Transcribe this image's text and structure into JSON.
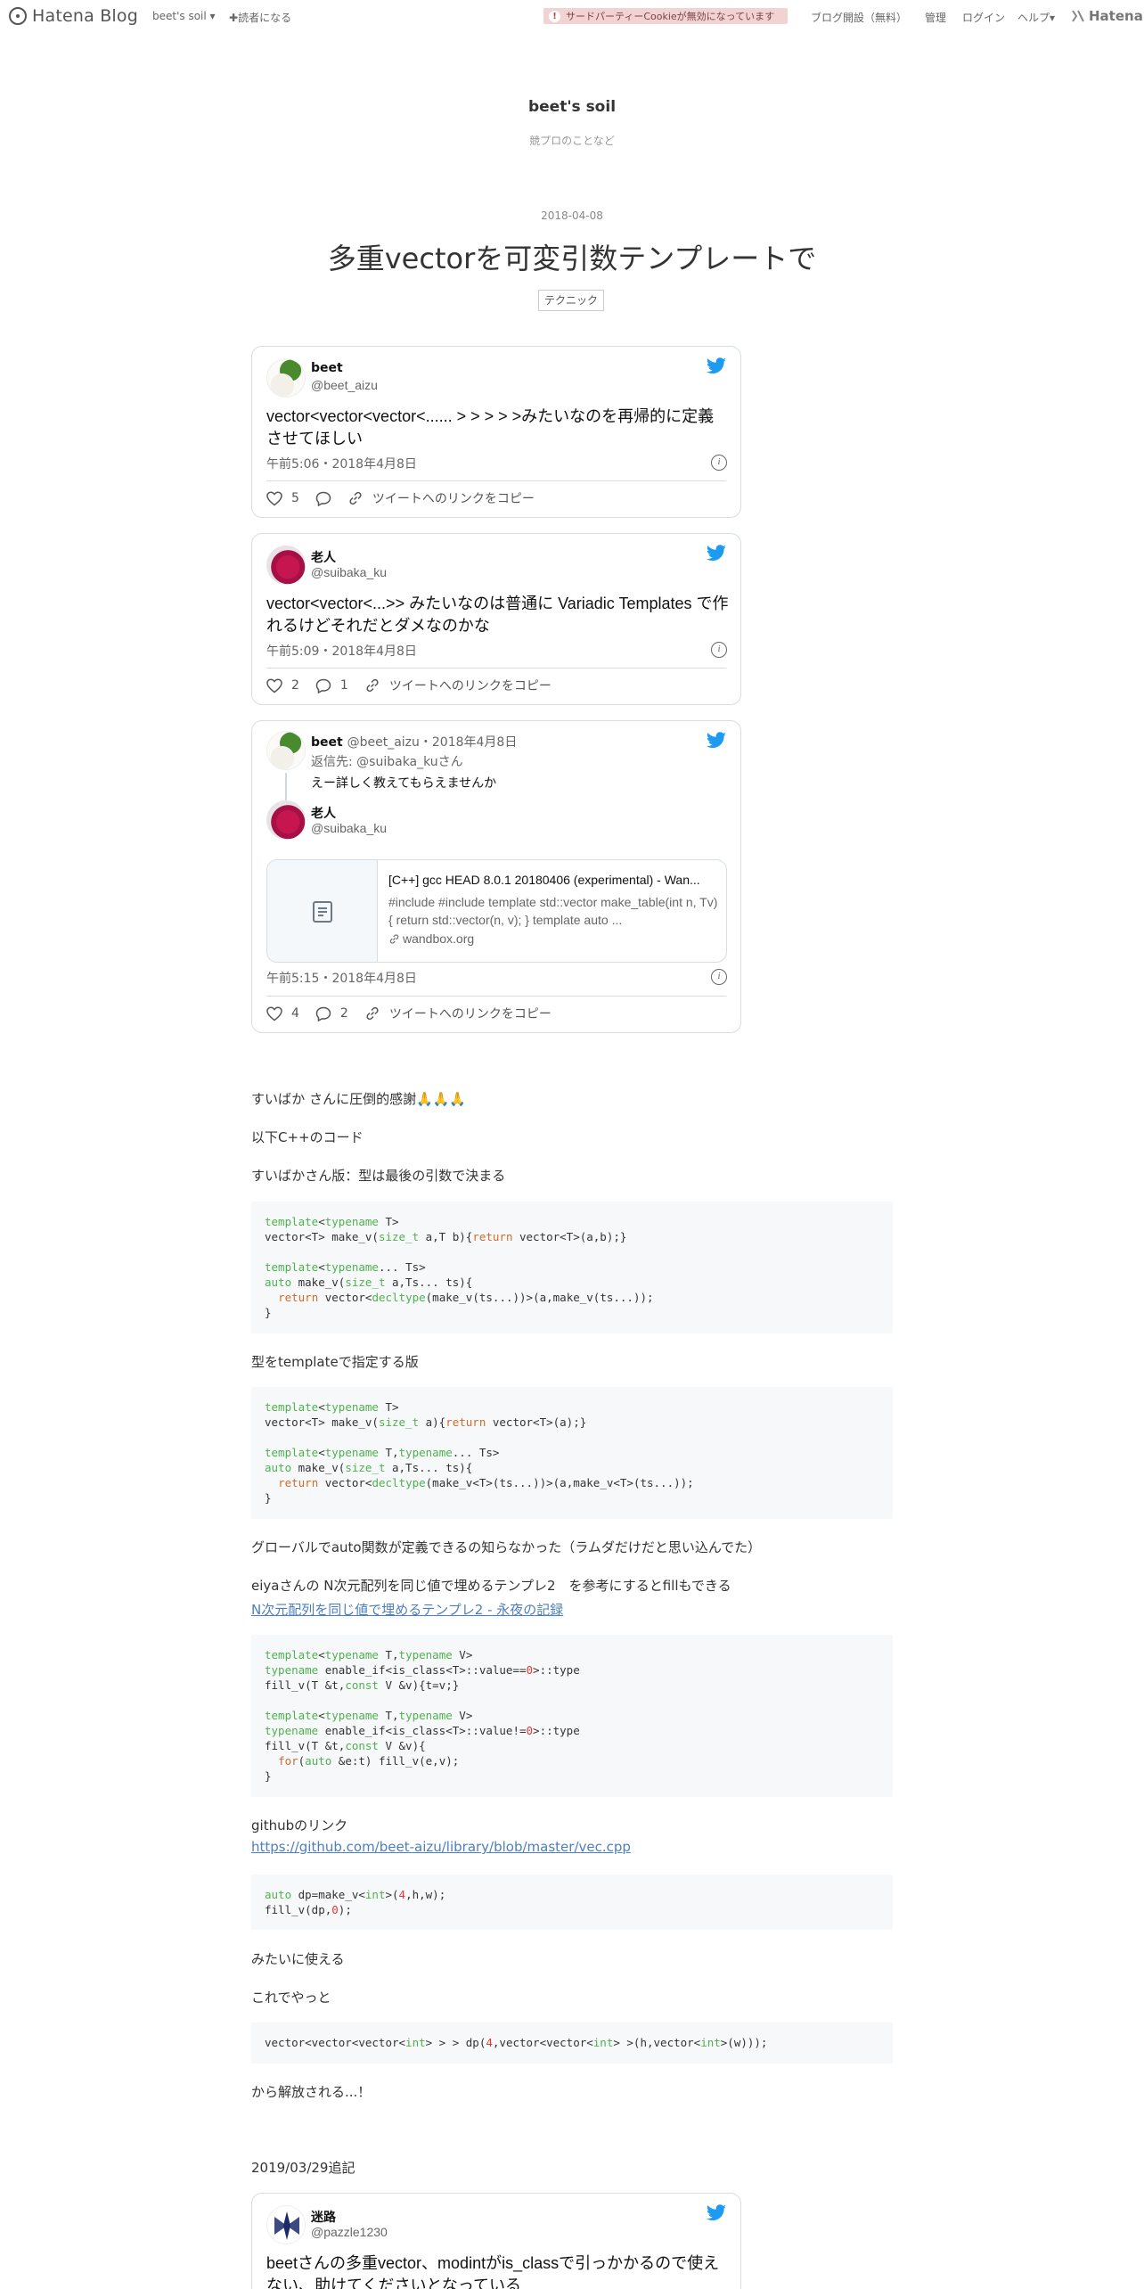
{
  "global_header": {
    "logo_text": "Hatena Blog",
    "blog_menu": "beet's soil",
    "subscribe": "読者になる",
    "notice": "サードパーティーCookieが無効になっています",
    "open_blog": "ブログ開設（無料）",
    "admin": "管理",
    "login": "ログイン",
    "help": "ヘルプ",
    "hatena": "Hatena"
  },
  "blog": {
    "title": "beet's soil",
    "description": "競プロのことなど"
  },
  "entry": {
    "date": "2018-04-08",
    "title": "多重vectorを可変引数テンプレートで",
    "category": "テクニック"
  },
  "tweets": [
    {
      "name": "beet",
      "handle": "@beet_aizu",
      "text": "vector<vector<vector<...... > > > > >みたいなのを再帰的に定義させてほしい",
      "meta": "午前5:06・2018年4月8日",
      "likes": "5",
      "copy_link": "ツイートへのリンクをコピー"
    },
    {
      "name": "老人",
      "handle": "@suibaka_ku",
      "text": "vector<vector<...>> みたいなのは普通に Variadic Templates で作れるけどそれだとダメなのかな",
      "meta": "午前5:09・2018年4月8日",
      "likes": "2",
      "replies": "1",
      "copy_link": "ツイートへのリンクをコピー"
    },
    {
      "parent_name": "beet",
      "parent_handle_date": "@beet_aizu・2018年4月8日",
      "reply_to": "返信先: @suibaka_kuさん",
      "parent_text": "えー詳しく教えてもらえませんか",
      "name": "老人",
      "handle": "@suibaka_ku",
      "card_title": "[C++] gcc HEAD 8.0.1 20180406 (experimental) - Wan...",
      "card_desc": "#include #include template std::vector make_table(int n, Tv) { return std::vector(n, v); } template auto ...",
      "card_domain": "wandbox.org",
      "meta": "午前5:15・2018年4月8日",
      "likes": "4",
      "replies": "2",
      "copy_link": "ツイートへのリンクをコピー"
    },
    {
      "name": "迷路",
      "handle": "@pazzle1230",
      "text": "beetさんの多重vector、modintがis_classで引っかかるので使えない、助けてくださいとなっている"
    }
  ],
  "body": {
    "p1": "すいばか さんに圧倒的感謝🙏🙏🙏",
    "p2": "以下C++のコード",
    "p3": "すいばかさん版：型は最後の引数で決まる",
    "p4": "型をtemplateで指定する版",
    "p5": "グローバルでauto関数が定義できるの知らなかった（ラムダだけだと思い込んでた）",
    "p6": "eiyaさんの N次元配列を同じ値で埋めるテンプレ2　を参考にするとfillもできる",
    "link1": "N次元配列を同じ値で埋めるテンプレ2 - 永夜の記録",
    "p7": "githubのリンク",
    "link2": "https://github.com/beet-aizu/library/blob/master/vec.cpp",
    "p8": "みたいに使える",
    "p9": "これでやっと",
    "p10": "から解放される...！",
    "p11": "2019/03/29追記"
  }
}
